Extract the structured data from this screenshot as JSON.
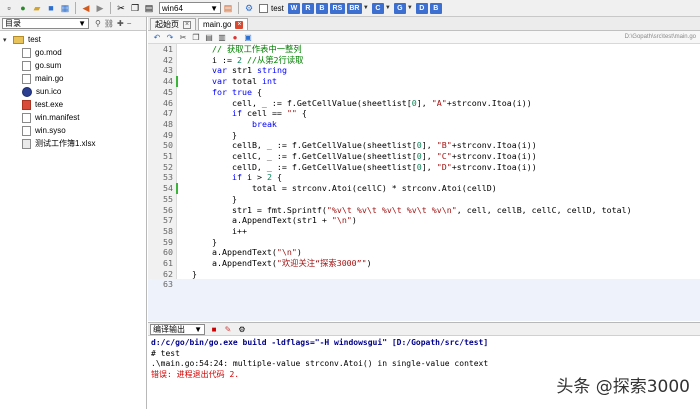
{
  "toolbar": {
    "arch_select": "win64",
    "checkbox_label": "test",
    "letter_buttons": [
      "W",
      "R",
      "B",
      "RS",
      "BR",
      "C",
      "G",
      "D",
      "B"
    ]
  },
  "sidebar": {
    "view_select": "目录",
    "root": "test",
    "files": [
      {
        "name": "go.mod",
        "type": "file"
      },
      {
        "name": "go.sum",
        "type": "file"
      },
      {
        "name": "main.go",
        "type": "file"
      },
      {
        "name": "sun.ico",
        "type": "ico"
      },
      {
        "name": "test.exe",
        "type": "exe"
      },
      {
        "name": "win.manifest",
        "type": "file"
      },
      {
        "name": "win.syso",
        "type": "file"
      },
      {
        "name": "测试工作簿1.xlsx",
        "type": "xlsx"
      }
    ]
  },
  "tabs": [
    {
      "label": "起始页",
      "active": false
    },
    {
      "label": "main.go",
      "active": true
    }
  ],
  "editor": {
    "path": "D:\\Gopath\\src\\test\\main.go",
    "lines": [
      {
        "n": "41",
        "changed": false,
        "html": "    <span class='cmt'>// 获取工作表中一整列</span>"
      },
      {
        "n": "42",
        "changed": false,
        "html": "    i := <span class='num'>2</span> <span class='cmt'>//从第2行读取</span>"
      },
      {
        "n": "43",
        "changed": false,
        "html": "    <span class='kw'>var</span> str1 <span class='kw'>string</span>"
      },
      {
        "n": "44",
        "changed": true,
        "html": "    <span class='kw'>var</span> total <span class='kw'>int</span>"
      },
      {
        "n": "45",
        "changed": false,
        "html": "    <span class='kw'>for</span> <span class='kw'>true</span> {"
      },
      {
        "n": "46",
        "changed": false,
        "html": "        cell, _ := f.GetCellValue(sheetlist[<span class='num'>0</span>], <span class='str'>\"A\"</span>+strconv.Itoa(i))"
      },
      {
        "n": "47",
        "changed": false,
        "html": "        <span class='kw'>if</span> cell == <span class='str'>\"\"</span> {"
      },
      {
        "n": "48",
        "changed": false,
        "html": "            <span class='kw'>break</span>"
      },
      {
        "n": "49",
        "changed": false,
        "html": "        }"
      },
      {
        "n": "50",
        "changed": false,
        "html": "        cellB, _ := f.GetCellValue(sheetlist[<span class='num'>0</span>], <span class='str'>\"B\"</span>+strconv.Itoa(i))"
      },
      {
        "n": "51",
        "changed": false,
        "html": "        cellC, _ := f.GetCellValue(sheetlist[<span class='num'>0</span>], <span class='str'>\"C\"</span>+strconv.Itoa(i))"
      },
      {
        "n": "52",
        "changed": false,
        "html": "        cellD, _ := f.GetCellValue(sheetlist[<span class='num'>0</span>], <span class='str'>\"D\"</span>+strconv.Itoa(i))"
      },
      {
        "n": "53",
        "changed": false,
        "html": "        <span class='kw'>if</span> i > <span class='num'>2</span> {"
      },
      {
        "n": "54",
        "changed": true,
        "html": "            total = strconv.Atoi(cellC) * strconv.Atoi(cellD)"
      },
      {
        "n": "55",
        "changed": false,
        "html": "        }"
      },
      {
        "n": "56",
        "changed": false,
        "html": "        str1 = fmt.Sprintf(<span class='str'>\"%v\\t %v\\t %v\\t %v\\t %v\\n\"</span>, cell, cellB, cellC, cellD, total)"
      },
      {
        "n": "57",
        "changed": false,
        "html": "        a.AppendText(str1 + <span class='str'>\"\\n\"</span>)"
      },
      {
        "n": "58",
        "changed": false,
        "html": "        i++"
      },
      {
        "n": "59",
        "changed": false,
        "html": "    }"
      },
      {
        "n": "60",
        "changed": false,
        "html": "    a.AppendText(<span class='str'>\"\\n\"</span>)"
      },
      {
        "n": "61",
        "changed": false,
        "html": "    a.AppendText(<span class='str'>\"欢迎关注“探索3000”\"</span>)"
      },
      {
        "n": "62",
        "changed": false,
        "html": "}"
      },
      {
        "n": "63",
        "changed": false,
        "html": ""
      }
    ]
  },
  "output": {
    "select": "编译输出",
    "lines": [
      "d:/c/go/bin/go.exe build -ldflags=\"-H windowsgui\" [D:/Gopath/src/test]",
      "# test",
      ".\\main.go:54:24: multiple-value strconv.Atoi() in single-value context",
      "错误: 进程退出代码 2."
    ]
  },
  "watermark": "头条 @探索3000",
  "colors": {
    "accent": "#3d6fd1",
    "keyword": "#0000ff",
    "string": "#a31515",
    "comment": "#008000",
    "error": "#d00000"
  }
}
